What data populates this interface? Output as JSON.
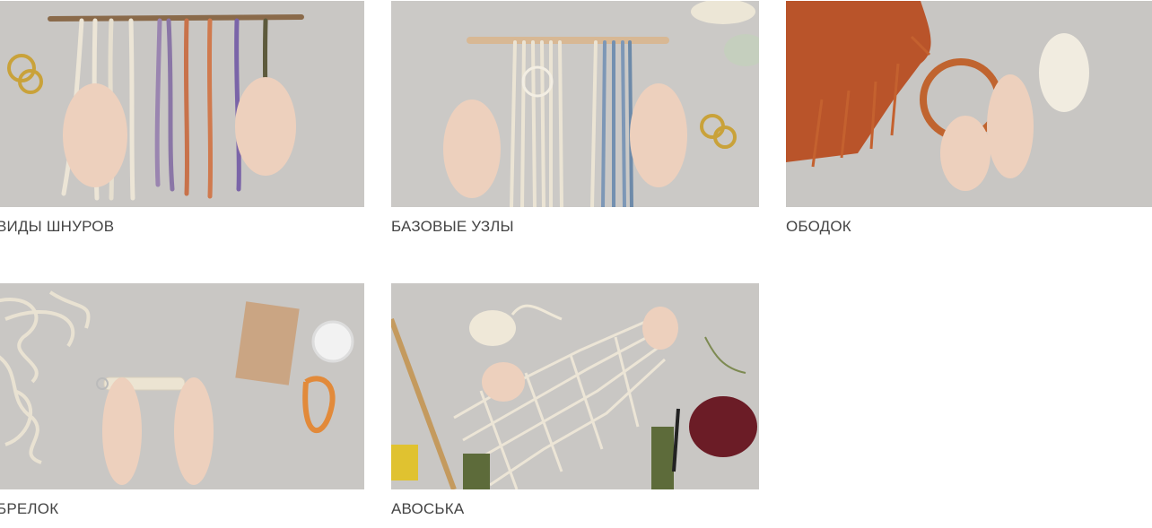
{
  "lessons": [
    {
      "title": "ВИДЫ ШНУРОВ",
      "image": "macrame-cord-types-photo"
    },
    {
      "title": "БАЗОВЫЕ УЗЛЫ",
      "image": "macrame-basic-knots-photo"
    },
    {
      "title": "ОБОДОК",
      "image": "macrame-headband-photo"
    },
    {
      "title": "БРЕЛОК",
      "image": "macrame-keychain-photo"
    },
    {
      "title": "АВОСЬКА",
      "image": "macrame-string-bag-photo"
    }
  ]
}
